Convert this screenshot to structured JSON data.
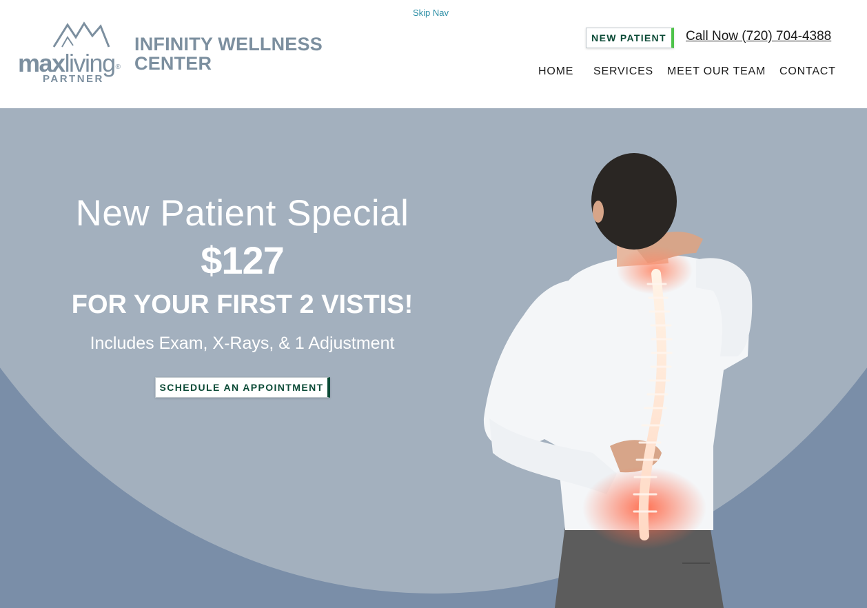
{
  "header": {
    "skip_nav": "Skip Nav",
    "logo": {
      "brand_bold": "max",
      "brand_light": "living",
      "registered": "®",
      "partner": "PARTNER",
      "center_line1": "INFINITY WELLNESS",
      "center_line2": "CENTER"
    },
    "new_patient_label": "NEW PATIENT",
    "call_now": "Call Now (720) 704-4388",
    "nav": [
      "HOME",
      "SERVICES",
      "MEET OUR TEAM",
      "CONTACT"
    ]
  },
  "hero": {
    "title": "New Patient Special",
    "price": "$127",
    "subtitle": "FOR YOUR FIRST 2 VISTIS!",
    "includes": "Includes Exam, X-Rays, & 1 Adjustment",
    "cta_label": "SCHEDULE AN APPOINTMENT",
    "image_subject": "man-holding-neck-and-back-with-highlighted-spine"
  },
  "colors": {
    "logo_gray": "#7c8f9f",
    "hero_dark": "#7a8ea8",
    "hero_light": "#a3b0be",
    "accent_green": "#4ec34a",
    "dark_green": "#0b4a36",
    "skip_link": "#2d8fa6"
  }
}
